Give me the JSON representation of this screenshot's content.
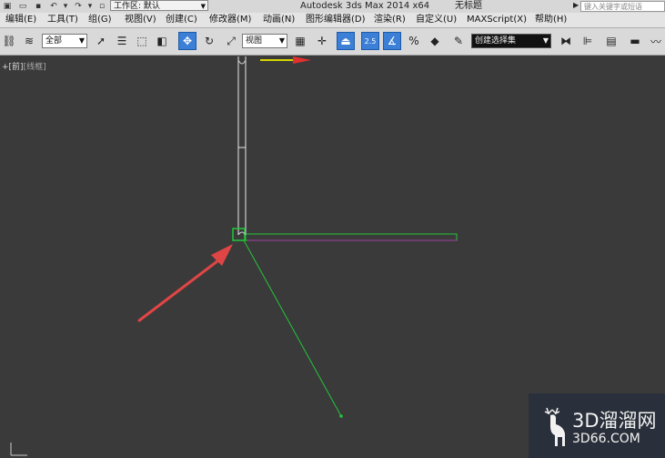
{
  "titlebar": {
    "workspace_label": "工作区: 默认",
    "app_title": "Autodesk 3ds Max  2014 x64",
    "document_title": "无标题",
    "search_placeholder": "键入关键字或短语"
  },
  "menu": {
    "items": [
      "编辑(E)",
      "工具(T)",
      "组(G)",
      "视图(V)",
      "创建(C)",
      "修改器(M)",
      "动画(N)",
      "图形编辑器(D)",
      "渲染(R)",
      "自定义(U)",
      "MAXScript(X)",
      "帮助(H)"
    ]
  },
  "toolbar": {
    "selection_filter": "全部",
    "reference_coord": "视图",
    "named_selection": "创建选择集",
    "snap_label": "2.5",
    "percent_snap_label": "%"
  },
  "viewport": {
    "label_plus": "+",
    "label_view": "[前]",
    "label_shading": "[线框]"
  },
  "watermark": {
    "brand": "3D溜溜网",
    "site": "3D66.COM"
  },
  "colors": {
    "viewport_bg": "#3a3a3a",
    "selection_green": "#22c53a",
    "annotation_red": "#e04545",
    "gizmo_purple": "#a040a0"
  }
}
